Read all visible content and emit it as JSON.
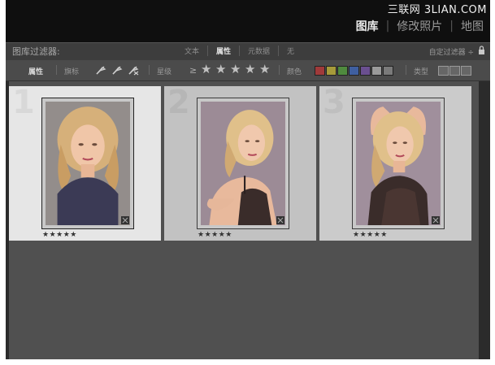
{
  "watermark": "三联网 3LIAN.COM",
  "modules": {
    "items": [
      {
        "label": "图库",
        "active": true
      },
      {
        "label": "修改照片",
        "active": false
      },
      {
        "label": "地图",
        "active": false
      }
    ]
  },
  "filter_bar": {
    "label": "图库过滤器:",
    "tabs": [
      {
        "label": "文本",
        "active": false
      },
      {
        "label": "属性",
        "active": true
      },
      {
        "label": "元数据",
        "active": false
      },
      {
        "label": "无",
        "active": false
      }
    ],
    "preset": "自定过滤器 ÷"
  },
  "attribute_bar": {
    "attribute_label": "属性",
    "flag_label": "旗标",
    "rating_label": "星级",
    "rating_operator": "≥",
    "stars": [
      "★",
      "★",
      "★",
      "★",
      "★"
    ],
    "color_label": "颜色",
    "colors": [
      "#a03a3a",
      "#a69a3a",
      "#4f8a3e",
      "#3f5fa0",
      "#6a4f90",
      "#9a9a9a",
      "#7a7a7a"
    ],
    "kind_label": "类型"
  },
  "grid": {
    "cells": [
      {
        "number": "1",
        "rating": "★★★★★",
        "selected": true,
        "bg": "#e6e6e6"
      },
      {
        "number": "2",
        "rating": "★★★★★",
        "selected": false,
        "bg": "#c2c2c2"
      },
      {
        "number": "3",
        "rating": "★★★★★",
        "selected": false,
        "bg": "#cbcbcb"
      }
    ]
  }
}
